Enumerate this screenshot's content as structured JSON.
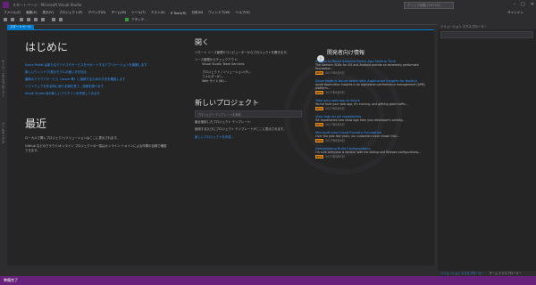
{
  "window": {
    "title": "スタートページ - Microsoft Visual Studio",
    "search_placeholder": "クイック起動 (Ctrl+Q)",
    "signin": "サインイン"
  },
  "menu": [
    "ファイル(F)",
    "編集(E)",
    "表示(V)",
    "プロジェクト(P)",
    "デバッグ(D)",
    "チーム(M)",
    "ツール(T)",
    "テスト(S)",
    "R Tools(R)",
    "分析(N)",
    "ウィンドウ(W)",
    "ヘルプ(H)"
  ],
  "toolbar": {
    "attach": "アタッチ..."
  },
  "tab": {
    "label": "スタートページ"
  },
  "left": {
    "server_explorer": "サーバー エクスプローラー",
    "toolbox": "ツールボックス"
  },
  "start": {
    "title": "はじめに",
    "links": [
      "Azure Portal は新たなデバイスやサービスをサポートするアプリケーションを構築します",
      "新しいウィンドウ/表示モデルの使い方を知る",
      "最新のクラウドサービス（Azure 等）に接続するための方法を確認します",
      "ソフトウェアを作る時に使う手順を見て、詳細を調べます",
      "Visual Studio 用の新しいプラグインを作成してみます"
    ],
    "recent_title": "最近",
    "recent_text1": "ローカルで開くプロジェクト/ソリューションはここに表示されます。",
    "recent_text2": "GitHub などのクラウド/オンライン プロジェクトの一覧はオンライン ドメインによる作業の目録で確認できます。",
    "open_title": "開く",
    "open_text": "リモート ソース管理やコンピューターからプロジェクトを開きます。",
    "checkout_label": "ソース管理からチェックアウト:",
    "vsts": "Visual Studio Team Services",
    "open_items": [
      "プロジェクト / ソリューション(P)...",
      "フォルダー(F)...",
      "Web サイト(W)..."
    ],
    "new_title": "新しいプロジェクト",
    "template_search": "プロジェクト テンプレートを検索",
    "recent_templates": "最近使用したプロジェクト テンプレート:",
    "new_desc": "使用するたびにプロジェクト テンプレートがここに表示されます。",
    "new_link": "新しいプロジェクトを作成..."
  },
  "news": {
    "title": "開発者向け情報",
    "items": [
      {
        "title": "5 Ways to Boost Xamarin.Forms App Startup Time",
        "body": "The Xamarin SDKs for iOS and Android provide an extremely performant foundation...",
        "date": "2017年6月6日"
      },
      {
        "title": "Solve Node.js Issues faster with Application Insights for Node.js",
        "body": "Azure Application Insights is an application performance management (APM) platform...",
        "date": "2017年6月6日"
      },
      {
        "title": "Take your web app to Azure",
        "body": "You've built your web app, it's running, and getting good traffic...",
        "date": "2017年6月6日"
      },
      {
        "title": "View logs for git repositories",
        "body": "Git repositories now show logs from your developer's activity...",
        "date": "2017年6月6日"
      },
      {
        "title": "Microsoft joins Cloud Foundry Foundation",
        "body": "Over the past few years, our customers have shown that...",
        "date": "2017年6月6日"
      },
      {
        "title": "Demystifying Build Configurations",
        "body": "I'm sure everyone is familiar with the Debug and Release configurations...",
        "date": "2017年6月5日"
      }
    ],
    "new_badge": "NEW"
  },
  "solution_explorer": {
    "title": "ソリューション エクスプローラー",
    "tabs": [
      "ソリューション エクスプローラー",
      "チーム エクスプローラー"
    ]
  },
  "status": "準備完了"
}
